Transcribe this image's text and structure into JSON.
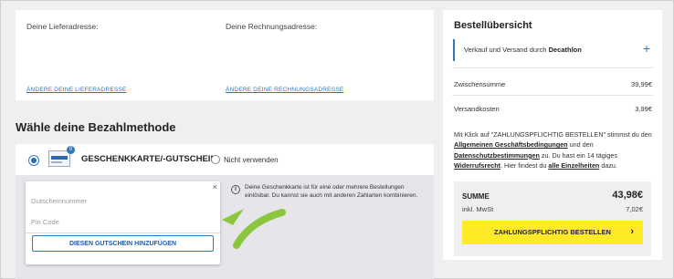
{
  "address": {
    "delivery_label": "Deine Lieferadresse:",
    "billing_label": "Deine Rechnungsadresse:",
    "change_delivery": "ÄNDERE DEINE LIEFERADRESSE",
    "change_billing": "ÄNDERE DEINE RECHNUNGSADRESSE"
  },
  "payment": {
    "section_title": "Wähle deine Bezahlmethode",
    "method_title": "GESCHENKKARTE/-GUTSCHEIN",
    "badge_count": "0",
    "not_use_label": "Nicht verwenden",
    "voucher": {
      "code_placeholder": "Gutscheinnummer",
      "pin_placeholder": "Pin Code",
      "add_button": "DIESEN GUTSCHEIN HINZUFÜGEN",
      "close": "×"
    },
    "info_icon": "i",
    "info_text": "Deine Geschenkkarte ist für eine oder mehrere Bestellungen einlösbar. Du kannst sie auch mit anderen Zahlarten kombinieren."
  },
  "summary": {
    "title": "Bestellübersicht",
    "shipping_prefix": "Verkauf und Versand durch ",
    "shipping_seller": "Decathlon",
    "plus": "+",
    "subtotal_label": "Zwischensumme",
    "subtotal_value": "39,99€",
    "shipping_cost_label": "Versandkosten",
    "shipping_cost_value": "3,99€",
    "legal": {
      "t1": "Mit Klick auf \"ZAHLUNGSPFLICHTIG BESTELLEN\" stimmst du den ",
      "l1": "Allgemeinen Geschäftsbedingungen",
      "t2": " und den ",
      "l2": "Datenschutzbestimmungen",
      "t3": " zu. Du hast ein 14 tägiges ",
      "l3": "Widerrufsrecht",
      "t4": ". Hier findest du ",
      "l4": "alle Einzelheiten",
      "t5": " dazu."
    },
    "total_label": "SUMME",
    "total_value": "43,98€",
    "vat_label": "inkl. MwSt",
    "vat_value": "7,02€",
    "order_button": "ZAHLUNGSPFLICHTIG BESTELLEN",
    "chevron": "›"
  },
  "colors": {
    "accent_blue": "#2b78c2",
    "order_yellow": "#ffea28",
    "arrow_green": "#8cc63f"
  }
}
